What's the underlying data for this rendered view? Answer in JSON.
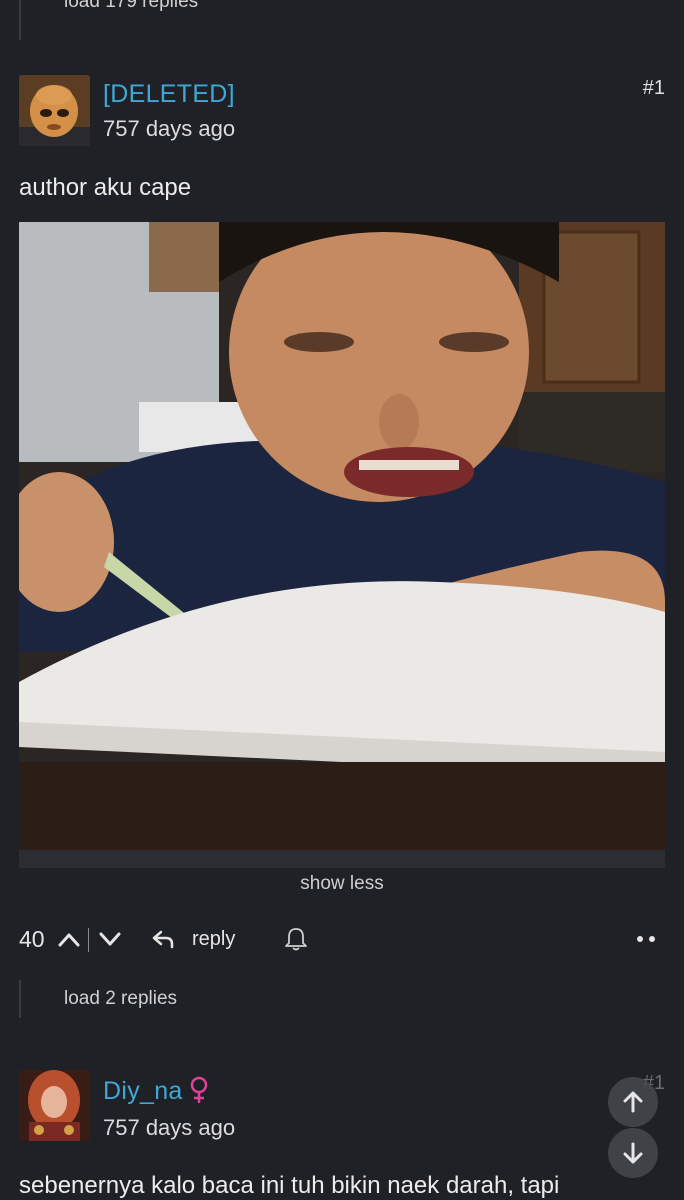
{
  "thread": {
    "load_replies_top": "load 179 replies"
  },
  "comments": [
    {
      "username": "[DELETED]",
      "timestamp": "757 days ago",
      "number": "#1",
      "text": "author aku cape",
      "image_icon": "crying-child-photo",
      "show_less": "show less",
      "votes": "40",
      "reply_label": "reply",
      "load_replies": "load 2 replies"
    },
    {
      "username": "Diy_na",
      "gender_icon": "female-icon",
      "timestamp": "757 days ago",
      "number": "#1",
      "text": "sebenernya kalo baca ini tuh bikin naek darah, tapi"
    }
  ],
  "colors": {
    "background": "#1f2126",
    "username": "#3ea8d6",
    "female_symbol": "#e0429a"
  }
}
